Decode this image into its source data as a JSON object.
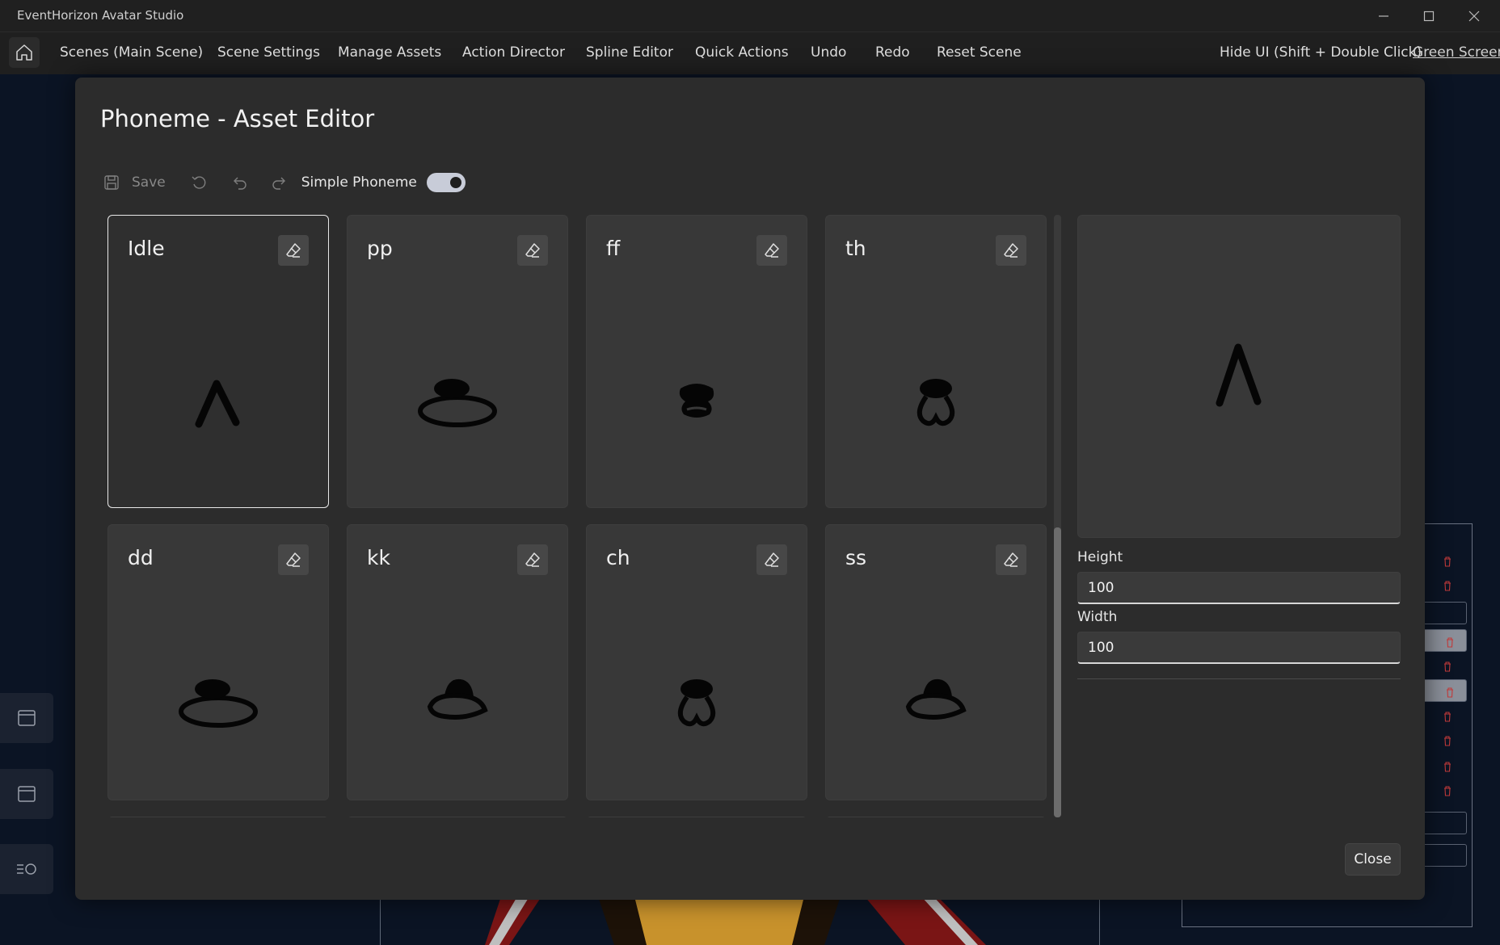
{
  "app_title": "EventHorizon Avatar Studio",
  "menu": {
    "items": [
      "Scenes (Main Scene)",
      "Scene Settings",
      "Manage Assets",
      "Action Director",
      "Spline Editor",
      "Quick Actions",
      "Undo",
      "Redo",
      "Reset Scene"
    ],
    "hide_ui": "Hide UI (Shift + Double Click)",
    "green_screen": "Green Screen"
  },
  "modal": {
    "title": "Phoneme - Asset Editor",
    "toolbar": {
      "save_label": "Save",
      "toggle_label": "Simple Phoneme",
      "toggle_on": true
    },
    "phonemes": [
      {
        "label": "Idle",
        "shape": "caret",
        "selected": true
      },
      {
        "label": "pp",
        "shape": "big-o"
      },
      {
        "label": "ff",
        "shape": "small-blob"
      },
      {
        "label": "th",
        "shape": "pinch"
      },
      {
        "label": "dd",
        "shape": "big-o"
      },
      {
        "label": "kk",
        "shape": "half"
      },
      {
        "label": "ch",
        "shape": "pinch"
      },
      {
        "label": "ss",
        "shape": "half"
      }
    ],
    "preview_shape": "caret",
    "height_label": "Height",
    "height_value": "100",
    "width_label": "Width",
    "width_value": "100",
    "close_label": "Close"
  }
}
